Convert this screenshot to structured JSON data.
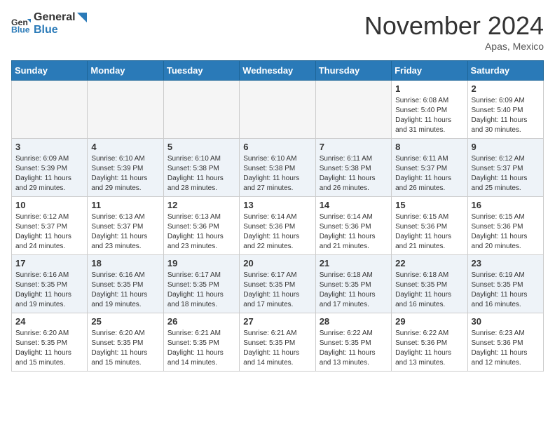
{
  "header": {
    "logo_line1": "General",
    "logo_line2": "Blue",
    "month": "November 2024",
    "location": "Apas, Mexico"
  },
  "weekdays": [
    "Sunday",
    "Monday",
    "Tuesday",
    "Wednesday",
    "Thursday",
    "Friday",
    "Saturday"
  ],
  "weeks": [
    [
      {
        "day": "",
        "info": ""
      },
      {
        "day": "",
        "info": ""
      },
      {
        "day": "",
        "info": ""
      },
      {
        "day": "",
        "info": ""
      },
      {
        "day": "",
        "info": ""
      },
      {
        "day": "1",
        "info": "Sunrise: 6:08 AM\nSunset: 5:40 PM\nDaylight: 11 hours\nand 31 minutes."
      },
      {
        "day": "2",
        "info": "Sunrise: 6:09 AM\nSunset: 5:40 PM\nDaylight: 11 hours\nand 30 minutes."
      }
    ],
    [
      {
        "day": "3",
        "info": "Sunrise: 6:09 AM\nSunset: 5:39 PM\nDaylight: 11 hours\nand 29 minutes."
      },
      {
        "day": "4",
        "info": "Sunrise: 6:10 AM\nSunset: 5:39 PM\nDaylight: 11 hours\nand 29 minutes."
      },
      {
        "day": "5",
        "info": "Sunrise: 6:10 AM\nSunset: 5:38 PM\nDaylight: 11 hours\nand 28 minutes."
      },
      {
        "day": "6",
        "info": "Sunrise: 6:10 AM\nSunset: 5:38 PM\nDaylight: 11 hours\nand 27 minutes."
      },
      {
        "day": "7",
        "info": "Sunrise: 6:11 AM\nSunset: 5:38 PM\nDaylight: 11 hours\nand 26 minutes."
      },
      {
        "day": "8",
        "info": "Sunrise: 6:11 AM\nSunset: 5:37 PM\nDaylight: 11 hours\nand 26 minutes."
      },
      {
        "day": "9",
        "info": "Sunrise: 6:12 AM\nSunset: 5:37 PM\nDaylight: 11 hours\nand 25 minutes."
      }
    ],
    [
      {
        "day": "10",
        "info": "Sunrise: 6:12 AM\nSunset: 5:37 PM\nDaylight: 11 hours\nand 24 minutes."
      },
      {
        "day": "11",
        "info": "Sunrise: 6:13 AM\nSunset: 5:37 PM\nDaylight: 11 hours\nand 23 minutes."
      },
      {
        "day": "12",
        "info": "Sunrise: 6:13 AM\nSunset: 5:36 PM\nDaylight: 11 hours\nand 23 minutes."
      },
      {
        "day": "13",
        "info": "Sunrise: 6:14 AM\nSunset: 5:36 PM\nDaylight: 11 hours\nand 22 minutes."
      },
      {
        "day": "14",
        "info": "Sunrise: 6:14 AM\nSunset: 5:36 PM\nDaylight: 11 hours\nand 21 minutes."
      },
      {
        "day": "15",
        "info": "Sunrise: 6:15 AM\nSunset: 5:36 PM\nDaylight: 11 hours\nand 21 minutes."
      },
      {
        "day": "16",
        "info": "Sunrise: 6:15 AM\nSunset: 5:36 PM\nDaylight: 11 hours\nand 20 minutes."
      }
    ],
    [
      {
        "day": "17",
        "info": "Sunrise: 6:16 AM\nSunset: 5:35 PM\nDaylight: 11 hours\nand 19 minutes."
      },
      {
        "day": "18",
        "info": "Sunrise: 6:16 AM\nSunset: 5:35 PM\nDaylight: 11 hours\nand 19 minutes."
      },
      {
        "day": "19",
        "info": "Sunrise: 6:17 AM\nSunset: 5:35 PM\nDaylight: 11 hours\nand 18 minutes."
      },
      {
        "day": "20",
        "info": "Sunrise: 6:17 AM\nSunset: 5:35 PM\nDaylight: 11 hours\nand 17 minutes."
      },
      {
        "day": "21",
        "info": "Sunrise: 6:18 AM\nSunset: 5:35 PM\nDaylight: 11 hours\nand 17 minutes."
      },
      {
        "day": "22",
        "info": "Sunrise: 6:18 AM\nSunset: 5:35 PM\nDaylight: 11 hours\nand 16 minutes."
      },
      {
        "day": "23",
        "info": "Sunrise: 6:19 AM\nSunset: 5:35 PM\nDaylight: 11 hours\nand 16 minutes."
      }
    ],
    [
      {
        "day": "24",
        "info": "Sunrise: 6:20 AM\nSunset: 5:35 PM\nDaylight: 11 hours\nand 15 minutes."
      },
      {
        "day": "25",
        "info": "Sunrise: 6:20 AM\nSunset: 5:35 PM\nDaylight: 11 hours\nand 15 minutes."
      },
      {
        "day": "26",
        "info": "Sunrise: 6:21 AM\nSunset: 5:35 PM\nDaylight: 11 hours\nand 14 minutes."
      },
      {
        "day": "27",
        "info": "Sunrise: 6:21 AM\nSunset: 5:35 PM\nDaylight: 11 hours\nand 14 minutes."
      },
      {
        "day": "28",
        "info": "Sunrise: 6:22 AM\nSunset: 5:35 PM\nDaylight: 11 hours\nand 13 minutes."
      },
      {
        "day": "29",
        "info": "Sunrise: 6:22 AM\nSunset: 5:36 PM\nDaylight: 11 hours\nand 13 minutes."
      },
      {
        "day": "30",
        "info": "Sunrise: 6:23 AM\nSunset: 5:36 PM\nDaylight: 11 hours\nand 12 minutes."
      }
    ]
  ]
}
